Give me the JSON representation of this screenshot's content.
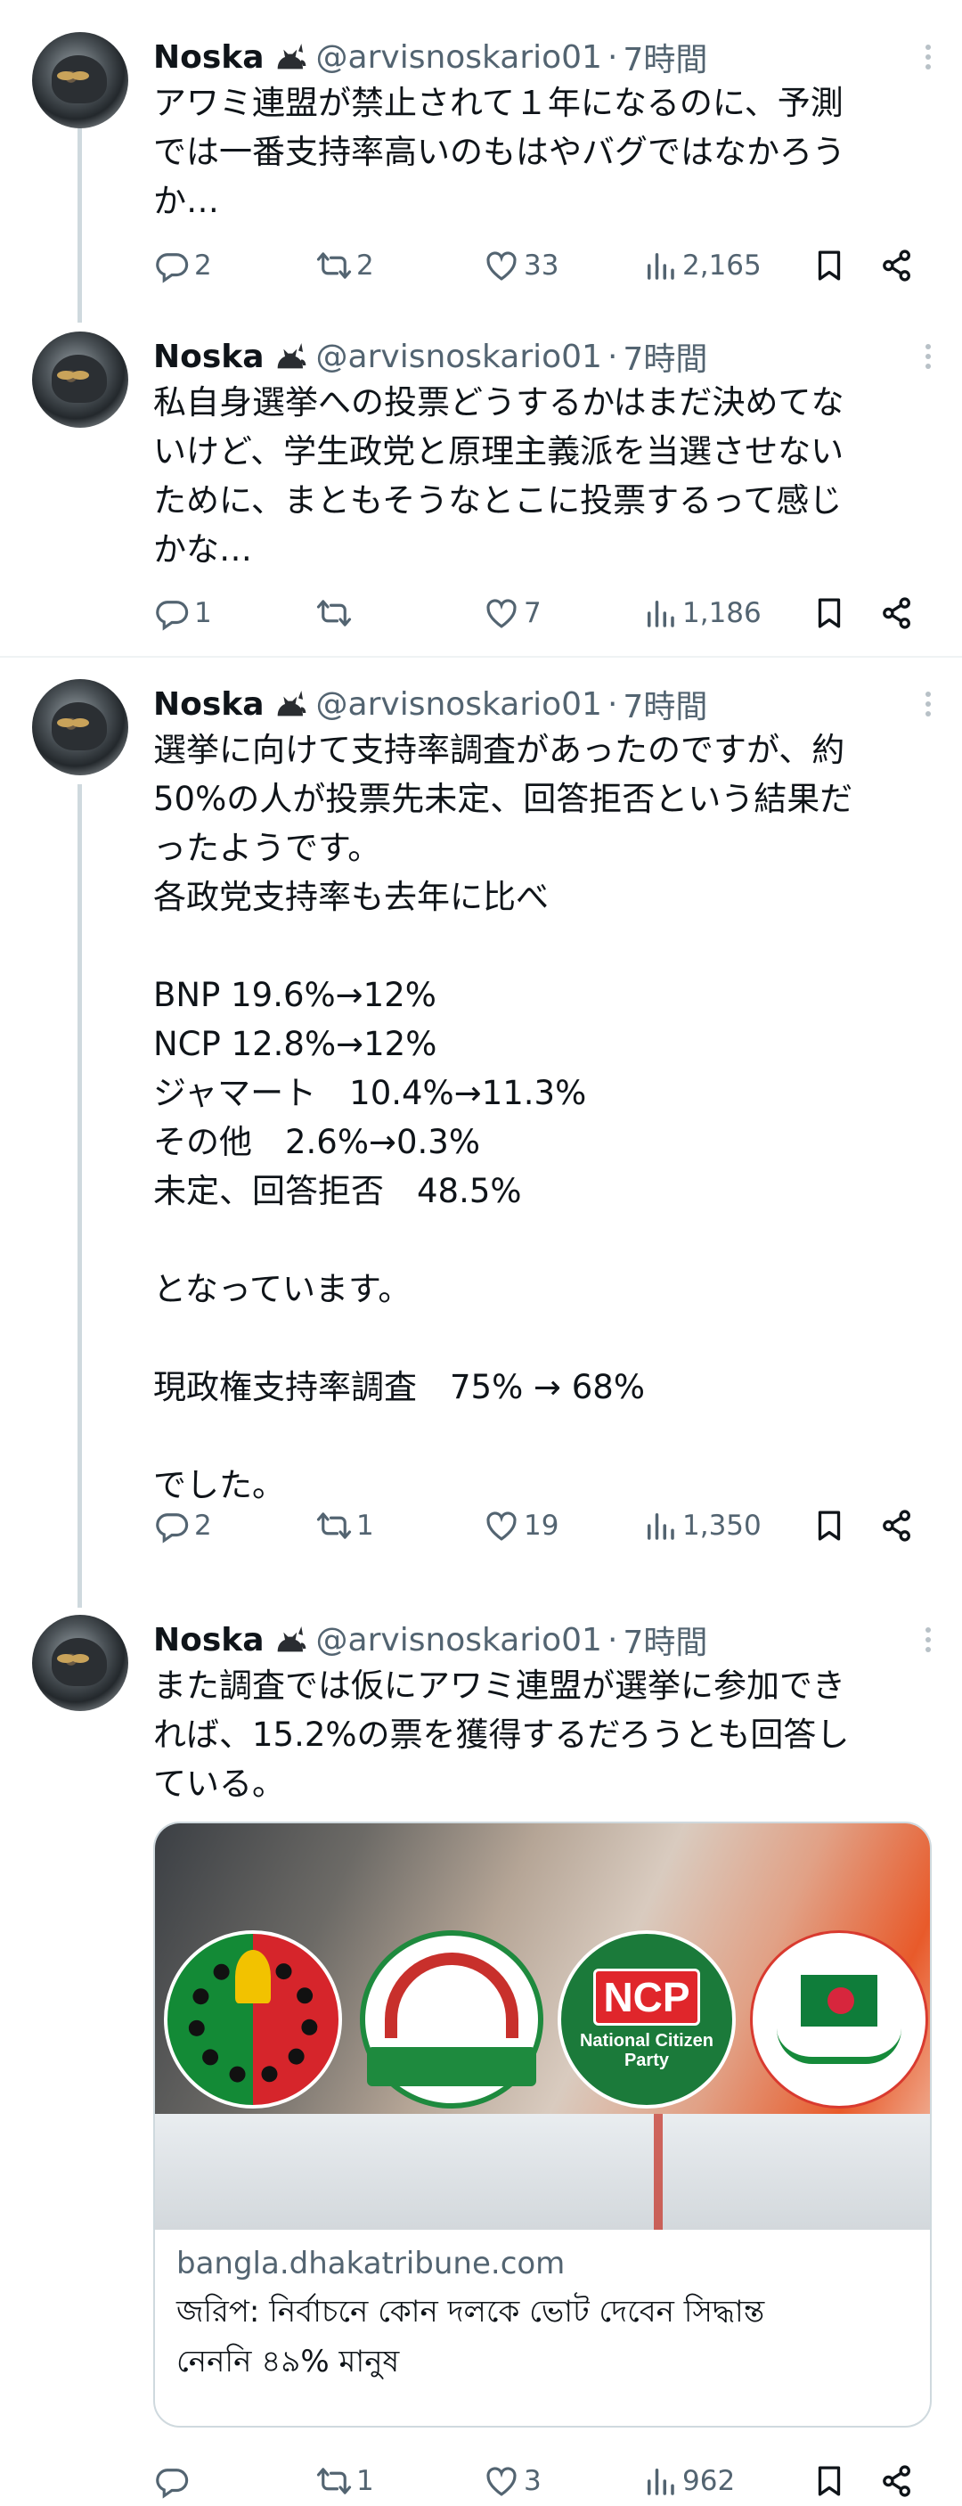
{
  "tweets": [
    {
      "name": "Noska",
      "handle": "@arvisnoskario01",
      "separator": "·",
      "time": "7時間",
      "text": "アワミ連盟が禁止されて１年になるのに、予測\nでは一番支持率高いのもはやバグではなかろう\nか…",
      "replies": "2",
      "retweets": "2",
      "likes": "33",
      "views": "2,165"
    },
    {
      "name": "Noska",
      "handle": "@arvisnoskario01",
      "separator": "·",
      "time": "7時間",
      "text": "私自身選挙への投票どうするかはまだ決めてな\nいけど、学生政党と原理主義派を当選させない\nために、まともそうなとこに投票するって感じ\nかな…",
      "replies": "1",
      "retweets": "",
      "likes": "7",
      "views": "1,186"
    },
    {
      "name": "Noska",
      "handle": "@arvisnoskario01",
      "separator": "·",
      "time": "7時間",
      "text": "選挙に向けて支持率調査があったのですが、約\n50%の人が投票先未定、回答拒否という結果だ\nったようです。\n各政党支持率も去年に比べ\n\nBNP 19.6%→12%\nNCP 12.8%→12%\nジャマート　10.4%→11.3%\nその他　2.6%→0.3%\n未定、回答拒否　48.5%\n\nとなっています。\n\n現政権支持率調査　75% → 68%\n\nでした。",
      "replies": "2",
      "retweets": "1",
      "likes": "19",
      "views": "1,350"
    },
    {
      "name": "Noska",
      "handle": "@arvisnoskario01",
      "separator": "·",
      "time": "7時間",
      "text": "また調査では仮にアワミ連盟が選挙に参加でき\nれば、15.2%の票を獲得するだろうとも回答し\nている。",
      "replies": "",
      "retweets": "1",
      "likes": "3",
      "views": "962",
      "card": {
        "logos": {
          "ncp_abbr": "NCP",
          "ncp_name": "National Citizen\nParty"
        },
        "domain": "bangla.dhakatribune.com",
        "title": "জরিপ: নির্বাচনে কোন দলকে ভোট দেবেন সিদ্ধান্ত\nনেননি ৪৯% মানুষ"
      }
    }
  ],
  "icons": {
    "reply": "reply-icon",
    "retweet": "retweet-icon",
    "like": "heart-icon",
    "views": "views-icon",
    "bookmark": "bookmark-icon",
    "share": "share-icon",
    "more": "more-icon",
    "badge": "cat-emoji-icon"
  },
  "colors": {
    "text": "#0f1419",
    "secondary": "#536471",
    "thread_line": "#cfd9de",
    "divider": "#eff3f4"
  }
}
